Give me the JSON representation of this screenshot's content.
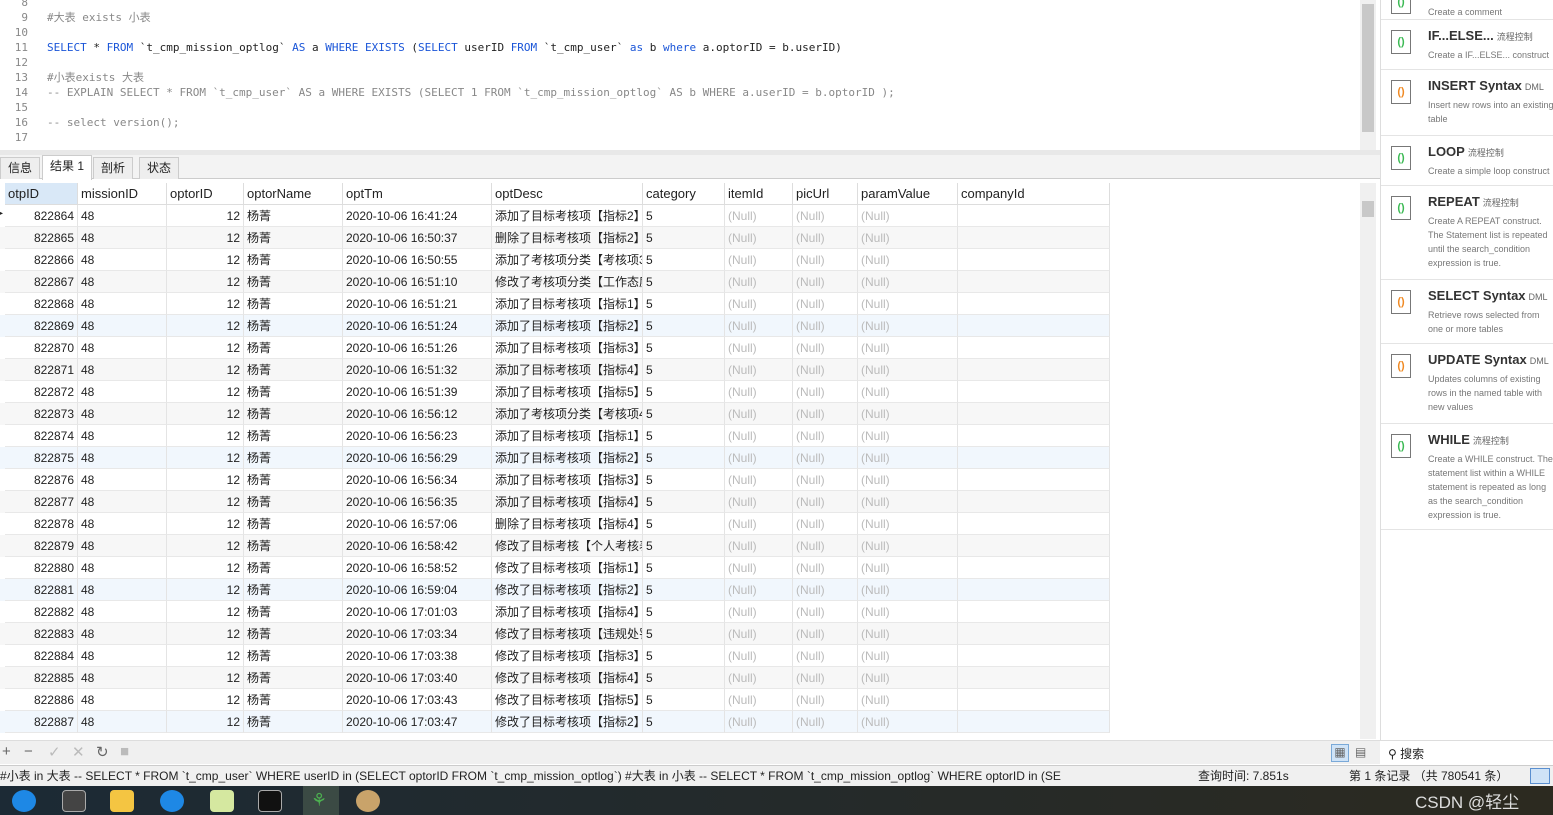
{
  "editor": {
    "lines": [
      {
        "n": "8",
        "t": ""
      },
      {
        "n": "9",
        "t": "#大表 exists 小表",
        "type": "comment"
      },
      {
        "n": "10",
        "t": ""
      },
      {
        "n": "11",
        "t": "SELECT * FROM `t_cmp_mission_optlog` AS a WHERE EXISTS (SELECT userID FROM `t_cmp_user` as b where a.optorID = b.userID)",
        "type": "sql"
      },
      {
        "n": "12",
        "t": ""
      },
      {
        "n": "13",
        "t": "#小表exists 大表",
        "type": "comment"
      },
      {
        "n": "14",
        "t": "-- EXPLAIN SELECT * FROM `t_cmp_user` AS a WHERE EXISTS (SELECT 1 FROM `t_cmp_mission_optlog` AS b WHERE a.userID = b.optorID );",
        "type": "comment"
      },
      {
        "n": "15",
        "t": ""
      },
      {
        "n": "16",
        "t": "-- select version();",
        "type": "comment"
      },
      {
        "n": "17",
        "t": ""
      }
    ]
  },
  "tabs": [
    "信息",
    "结果 1",
    "剖析",
    "状态"
  ],
  "active_tab": "结果 1",
  "grid": {
    "columns": [
      "otpID",
      "missionID",
      "optorID",
      "optorName",
      "optTm",
      "optDesc",
      "category",
      "itemId",
      "picUrl",
      "paramValue",
      "companyId"
    ],
    "null_text": "(Null)",
    "rows": [
      [
        "822864",
        "48",
        "12",
        "杨菁",
        "2020-10-06 16:41:24",
        "添加了目标考核项【指标2】",
        "5"
      ],
      [
        "822865",
        "48",
        "12",
        "杨菁",
        "2020-10-06 16:50:37",
        "删除了目标考核项【指标2】",
        "5"
      ],
      [
        "822866",
        "48",
        "12",
        "杨菁",
        "2020-10-06 16:50:55",
        "添加了考核项分类【考核项3",
        "5"
      ],
      [
        "822867",
        "48",
        "12",
        "杨菁",
        "2020-10-06 16:51:10",
        "修改了考核项分类【工作态度",
        "5"
      ],
      [
        "822868",
        "48",
        "12",
        "杨菁",
        "2020-10-06 16:51:21",
        "添加了目标考核项【指标1】",
        "5"
      ],
      [
        "822869",
        "48",
        "12",
        "杨菁",
        "2020-10-06 16:51:24",
        "添加了目标考核项【指标2】",
        "5"
      ],
      [
        "822870",
        "48",
        "12",
        "杨菁",
        "2020-10-06 16:51:26",
        "添加了目标考核项【指标3】",
        "5"
      ],
      [
        "822871",
        "48",
        "12",
        "杨菁",
        "2020-10-06 16:51:32",
        "添加了目标考核项【指标4】",
        "5"
      ],
      [
        "822872",
        "48",
        "12",
        "杨菁",
        "2020-10-06 16:51:39",
        "添加了目标考核项【指标5】",
        "5"
      ],
      [
        "822873",
        "48",
        "12",
        "杨菁",
        "2020-10-06 16:56:12",
        "添加了考核项分类【考核项4",
        "5"
      ],
      [
        "822874",
        "48",
        "12",
        "杨菁",
        "2020-10-06 16:56:23",
        "添加了目标考核项【指标1】",
        "5"
      ],
      [
        "822875",
        "48",
        "12",
        "杨菁",
        "2020-10-06 16:56:29",
        "添加了目标考核项【指标2】",
        "5"
      ],
      [
        "822876",
        "48",
        "12",
        "杨菁",
        "2020-10-06 16:56:34",
        "添加了目标考核项【指标3】",
        "5"
      ],
      [
        "822877",
        "48",
        "12",
        "杨菁",
        "2020-10-06 16:56:35",
        "添加了目标考核项【指标4】",
        "5"
      ],
      [
        "822878",
        "48",
        "12",
        "杨菁",
        "2020-10-06 16:57:06",
        "删除了目标考核项【指标4】",
        "5"
      ],
      [
        "822879",
        "48",
        "12",
        "杨菁",
        "2020-10-06 16:58:42",
        "修改了目标考核【个人考核表",
        "5"
      ],
      [
        "822880",
        "48",
        "12",
        "杨菁",
        "2020-10-06 16:58:52",
        "修改了目标考核项【指标1】",
        "5"
      ],
      [
        "822881",
        "48",
        "12",
        "杨菁",
        "2020-10-06 16:59:04",
        "修改了目标考核项【指标2】",
        "5"
      ],
      [
        "822882",
        "48",
        "12",
        "杨菁",
        "2020-10-06 17:01:03",
        "添加了目标考核项【指标4】",
        "5"
      ],
      [
        "822883",
        "48",
        "12",
        "杨菁",
        "2020-10-06 17:03:34",
        "修改了目标考核项【违规处罚",
        "5"
      ],
      [
        "822884",
        "48",
        "12",
        "杨菁",
        "2020-10-06 17:03:38",
        "修改了目标考核项【指标3】",
        "5"
      ],
      [
        "822885",
        "48",
        "12",
        "杨菁",
        "2020-10-06 17:03:40",
        "修改了目标考核项【指标4】",
        "5"
      ],
      [
        "822886",
        "48",
        "12",
        "杨菁",
        "2020-10-06 17:03:43",
        "修改了目标考核项【指标5】",
        "5"
      ],
      [
        "822887",
        "48",
        "12",
        "杨菁",
        "2020-10-06 17:03:47",
        "修改了目标考核项【指标2】",
        "5"
      ]
    ]
  },
  "snippets": [
    {
      "title": "",
      "tag": "",
      "desc": "Create a comment",
      "icon": "comment-file-icon"
    },
    {
      "title": "IF...ELSE...",
      "tag": "流程控制",
      "desc": "Create a IF...ELSE... construct",
      "icon": "flow-file-icon"
    },
    {
      "title": "INSERT Syntax",
      "tag": "DML",
      "desc": "Insert new rows into an existing table",
      "icon": "dml-file-icon"
    },
    {
      "title": "LOOP",
      "tag": "流程控制",
      "desc": "Create a simple loop construct",
      "icon": "flow-file-icon"
    },
    {
      "title": "REPEAT",
      "tag": "流程控制",
      "desc": "Create A REPEAT construct. The Statement list is repeated until the search_condition expression is true.",
      "icon": "flow-file-icon"
    },
    {
      "title": "SELECT Syntax",
      "tag": "DML",
      "desc": "Retrieve rows selected from one or more tables",
      "icon": "dml-file-icon"
    },
    {
      "title": "UPDATE Syntax",
      "tag": "DML",
      "desc": "Updates columns of existing rows in the named table with new values",
      "icon": "dml-file-icon"
    },
    {
      "title": "WHILE",
      "tag": "流程控制",
      "desc": "Create a WHILE construct. The statement list within a WHILE statement is repeated as long as the search_condition expression is true.",
      "icon": "flow-file-icon"
    }
  ],
  "side_search": {
    "placeholder": "搜索"
  },
  "status": {
    "sql": "#小表 in 大表  -- SELECT * FROM `t_cmp_user` WHERE userID in (SELECT optorID FROM `t_cmp_mission_optlog`)  #大表 in 小表 -- SELECT * FROM `t_cmp_mission_optlog` WHERE optorID in (SE",
    "query_time": "查询时间: 7.851s",
    "records": "第 1 条记录 （共 780541 条）"
  },
  "watermark": "CSDN @轻尘",
  "colors": {
    "keyword": "#1a55d8",
    "comment": "#888888",
    "null": "#bbbbbb",
    "header_selected": "#d9e8f7"
  }
}
